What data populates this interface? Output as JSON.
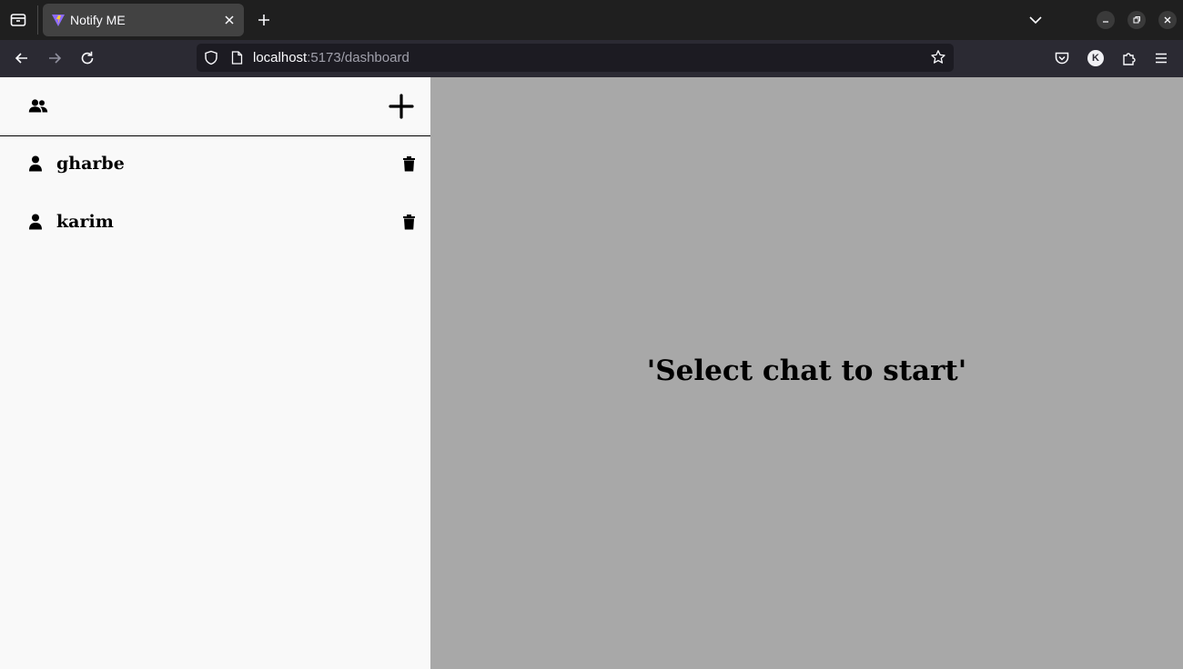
{
  "browser": {
    "tab": {
      "title": "Notify ME"
    },
    "url": {
      "host": "localhost",
      "rest": ":5173/dashboard"
    },
    "profile_initial": "K"
  },
  "sidebar": {
    "chats": [
      {
        "name": "gharbe"
      },
      {
        "name": "karim"
      }
    ]
  },
  "main": {
    "placeholder": "'Select chat to start'"
  },
  "colors": {
    "sidebar_bg": "#f9f9f9",
    "main_bg": "#a8a8a8",
    "tabbar_bg": "#1f1f1f",
    "navbar_bg": "#2b2a33"
  }
}
